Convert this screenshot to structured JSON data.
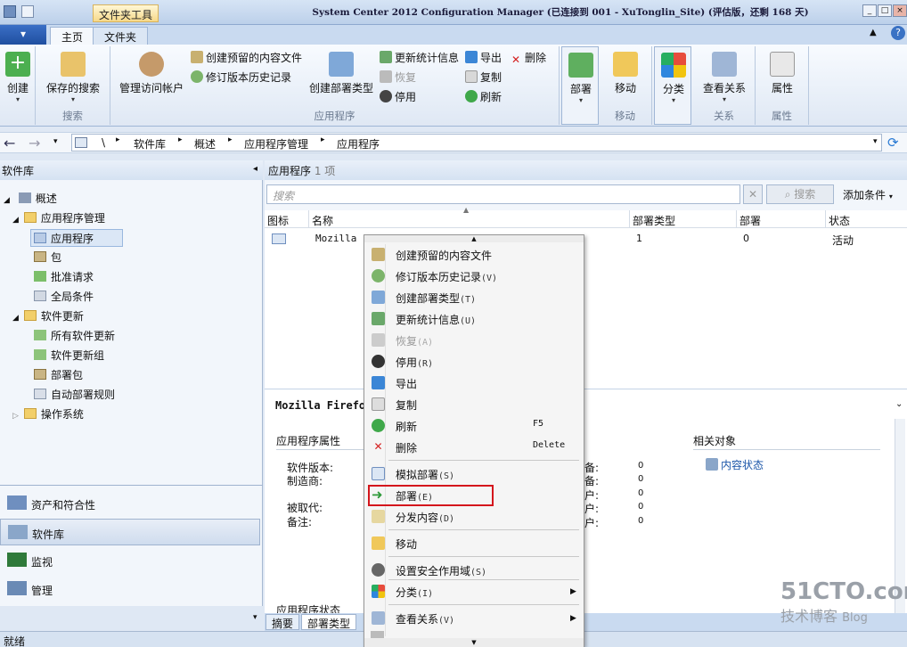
{
  "window": {
    "context_tab": "文件夹工具",
    "title": "System Center 2012 Configuration Manager (已连接到 001 - XuTonglin_Site) (评估版，还剩 168 天)"
  },
  "ribbon_tabs": [
    "主页",
    "文件夹"
  ],
  "ribbon": {
    "create": "创建",
    "saved_search": "保存的搜索",
    "search_group": "搜索",
    "manage_accounts": "管理访问帐户",
    "create_prestaged": "创建预留的内容文件",
    "revision_history": "修订版本历史记录",
    "create_deploy_type": "创建部署类型",
    "update_stats": "更新统计信息",
    "restore": "恢复",
    "retire": "停用",
    "export": "导出",
    "copy": "复制",
    "refresh": "刷新",
    "delete": "删除",
    "app_group": "应用程序",
    "deploy": "部署",
    "deploy_group": "部署",
    "move": "移动",
    "move_group": "移动",
    "categorize": "分类",
    "view_rel": "查看关系",
    "rel_group": "关系",
    "properties": "属性",
    "prop_group": "属性"
  },
  "breadcrumb": [
    "\\",
    "软件库",
    "概述",
    "应用程序管理",
    "应用程序"
  ],
  "left_nav": {
    "header": "软件库",
    "tree": [
      {
        "label": "概述"
      },
      {
        "label": "应用程序管理"
      },
      {
        "label": "应用程序"
      },
      {
        "label": "包"
      },
      {
        "label": "批准请求"
      },
      {
        "label": "全局条件"
      },
      {
        "label": "软件更新"
      },
      {
        "label": "所有软件更新"
      },
      {
        "label": "软件更新组"
      },
      {
        "label": "部署包"
      },
      {
        "label": "自动部署规则"
      },
      {
        "label": "操作系统"
      }
    ],
    "sections": [
      "资产和符合性",
      "软件库",
      "监视",
      "管理"
    ]
  },
  "main": {
    "header_title": "应用程序",
    "header_count": "1 项",
    "search_placeholder": "搜索",
    "search_button": "搜索",
    "add_criteria": "添加条件",
    "columns": [
      "图标",
      "名称",
      "部署类型",
      "部署",
      "状态"
    ],
    "row": {
      "name": "Mozilla F",
      "deploy_types": "1",
      "deployments": "0",
      "status": "活动"
    }
  },
  "details": {
    "title": "Mozilla Firefo",
    "props_header": "应用程序属性",
    "software_version": "软件版本:",
    "manufacturer": "制造商:",
    "superseded_by": "被取代:",
    "comments": "备注:",
    "stats_labels": [
      "备:",
      "备:",
      "户:",
      "户:",
      "户:",
      "户:"
    ],
    "stats_values": [
      "0",
      "0",
      "0",
      "0",
      "0",
      "0"
    ],
    "related_header": "相关对象",
    "content_status": "内容状态",
    "app_status": "应用程序状态",
    "tabs": [
      "摘要",
      "部署类型"
    ]
  },
  "context_menu": [
    {
      "label": "创建预留的内容文件",
      "key": ""
    },
    {
      "label": "修订版本历史记录",
      "key": "(V)"
    },
    {
      "label": "创建部署类型",
      "key": "(T)"
    },
    {
      "label": "更新统计信息",
      "key": "(U)"
    },
    {
      "label": "恢复",
      "key": "(A)"
    },
    {
      "label": "停用",
      "key": "(R)"
    },
    {
      "label": "导出",
      "key": ""
    },
    {
      "label": "复制",
      "key": ""
    },
    {
      "label": "刷新",
      "key": "",
      "shortcut": "F5"
    },
    {
      "label": "删除",
      "key": "",
      "shortcut": "Delete"
    },
    {
      "label": "模拟部署",
      "key": "(S)"
    },
    {
      "label": "部署",
      "key": "(E)"
    },
    {
      "label": "分发内容",
      "key": "(D)"
    },
    {
      "label": "移动",
      "key": ""
    },
    {
      "label": "设置安全作用域",
      "key": "(S)"
    },
    {
      "label": "分类",
      "key": "(I)"
    },
    {
      "label": "查看关系",
      "key": "(V)"
    }
  ],
  "status_bar": "就绪",
  "watermark": {
    "site": "51CTO.com",
    "sub": "技术博客",
    "blog": "Blog"
  }
}
